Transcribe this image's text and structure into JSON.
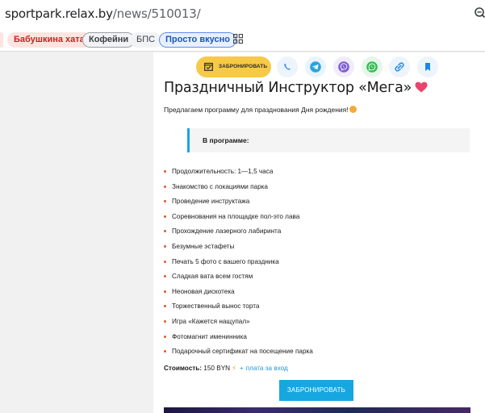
{
  "browser": {
    "url_host": "sportpark.relax.by",
    "url_path": "/news/510013/"
  },
  "bookmarks": [
    {
      "label": "Бабушкина хата",
      "style": "red"
    },
    {
      "label": "Кофейни",
      "style": "gray-outline"
    },
    {
      "label": "БПС",
      "style": "gray"
    },
    {
      "label": "Просто вкусно",
      "style": "blue"
    }
  ],
  "toolbar": {
    "book_label": "ЗАБРОНИРОВАТЬ",
    "colors": {
      "book": "#f7c948",
      "phone": "#1e88e5",
      "telegram": "#2aa3de",
      "viber": "#7b5ccf",
      "whatsapp": "#2fbf4e",
      "link": "#1e88e5",
      "bookmark": "#1e88e5"
    }
  },
  "article": {
    "title": "Праздничный Инструктор «Мега»",
    "intro": "Предлагаем программу для празднования Дня рождения!",
    "program_heading": "В программе:",
    "items": [
      "Продолжительность: 1—1,5 часа",
      "Знакомство с локациями парка",
      "Проведение инструктажа",
      "Соревнования на площадке пол-это лава",
      "Прохождение лазерного лабиринта",
      "Безумные эстафеты",
      "Печать 5 фото с вашего праздника",
      "Сладкая вата всем гостям",
      "Неоновая дискотека",
      "Торжественный вынос торта",
      "Игра «Кажется нащупал»",
      "Фотомагнит именинника",
      "Подарочный сертификат на посещение парка"
    ],
    "price_label": "Стоимость:",
    "price_value": "150 BYN",
    "price_plus": "+",
    "price_extra": "плата за вход",
    "cta_label": "ЗАБРОНИРОВАТЬ"
  }
}
